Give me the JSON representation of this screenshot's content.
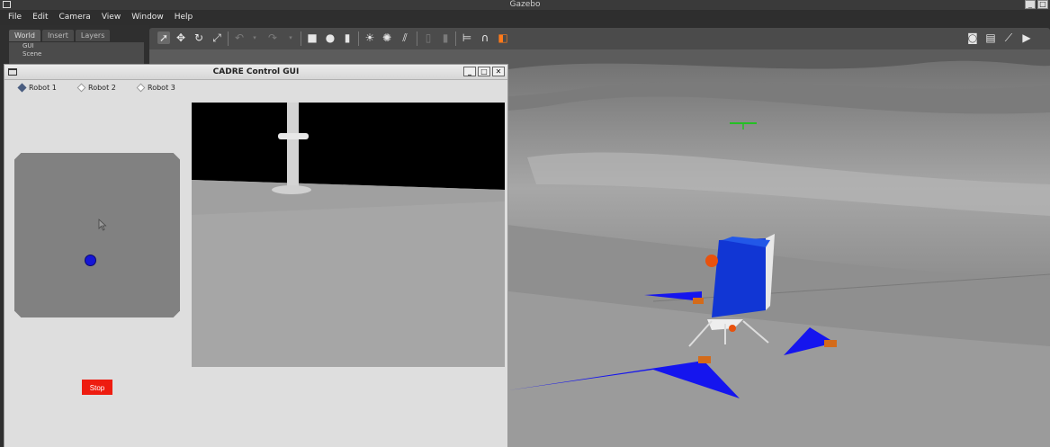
{
  "window": {
    "title": "Gazebo"
  },
  "menu": [
    "File",
    "Edit",
    "Camera",
    "View",
    "Window",
    "Help"
  ],
  "left_panel": {
    "tabs": [
      "World",
      "Insert",
      "Layers"
    ],
    "tree": [
      "GUI",
      "Scene"
    ]
  },
  "toolbar": {
    "left_tools": [
      "select-tool-icon",
      "translate-tool-icon",
      "rotate-tool-icon",
      "scale-tool-icon",
      "undo-icon",
      "redo-icon",
      "box-shape-icon",
      "sphere-shape-icon",
      "cylinder-shape-icon",
      "point-light-icon",
      "spot-light-icon",
      "directional-light-icon",
      "copy-icon",
      "paste-icon",
      "align-icon",
      "snap-icon",
      "view-angle-icon"
    ],
    "right_tools": [
      "screenshot-icon",
      "log-icon",
      "plot-icon",
      "record-video-icon"
    ]
  },
  "dialog": {
    "title": "CADRE Control GUI",
    "robots": [
      {
        "label": "Robot 1",
        "selected": true
      },
      {
        "label": "Robot 2",
        "selected": false
      },
      {
        "label": "Robot 3",
        "selected": false
      }
    ],
    "stop_label": "Stop",
    "stop_color": "#ee1c10",
    "joystick_color": "#1515d6"
  }
}
